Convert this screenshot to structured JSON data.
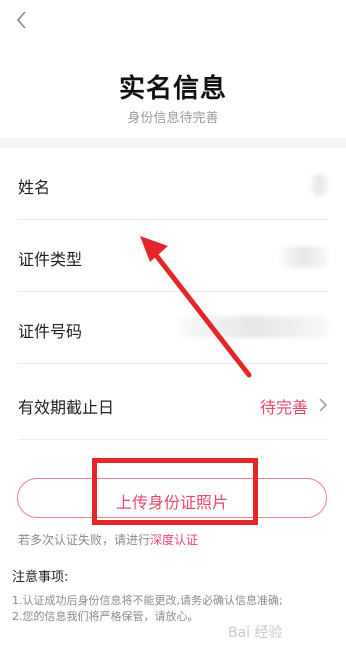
{
  "page": {
    "title": "实名信息",
    "subtitle": "身份信息待完善"
  },
  "fields": [
    {
      "label": "姓名"
    },
    {
      "label": "证件类型"
    },
    {
      "label": "证件号码"
    },
    {
      "label": "有效期截止日",
      "status": "待完善"
    }
  ],
  "upload": {
    "button_label": "上传身份证照片"
  },
  "hint": {
    "text": "若多次认证失败，请进行",
    "link": "深度认证"
  },
  "notes": {
    "title": "注意事项:",
    "items": [
      "1.认证成功后身份信息将不能更改,请务必确认信息准确;",
      "2.您的信息我们将严格保管，请放心。"
    ]
  },
  "watermark": {
    "text": "Bai 经验"
  },
  "colors": {
    "accent": "#e8476a",
    "annotation_red": "#e52528"
  }
}
